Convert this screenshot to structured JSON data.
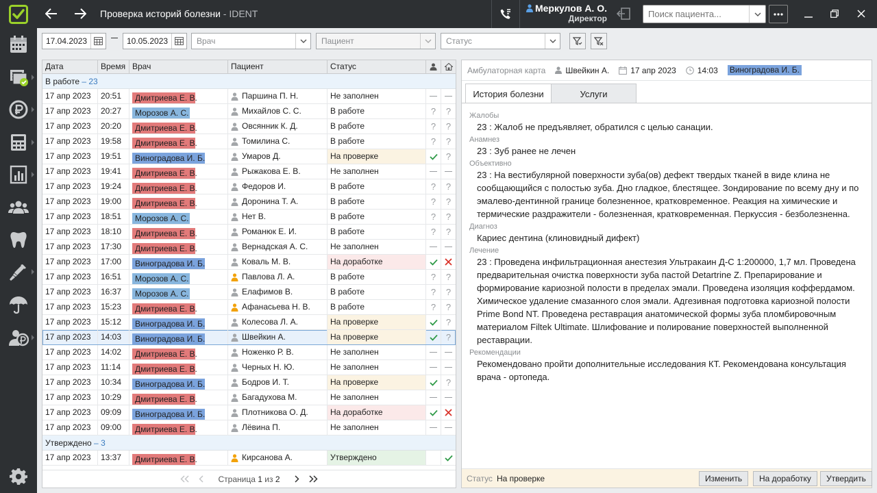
{
  "app": {
    "title": "Проверка историй болезни",
    "name": "IDENT"
  },
  "user": {
    "name": "Меркулов А. О.",
    "role": "Директор"
  },
  "search": {
    "placeholder": "Поиск пациента..."
  },
  "filters": {
    "date_from": "17.04.2023",
    "date_to": "10.05.2023",
    "doctor_placeholder": "Врач",
    "patient_placeholder": "Пациент",
    "status_placeholder": "Статус"
  },
  "table": {
    "columns": [
      "Дата",
      "Время",
      "Врач",
      "Пациент",
      "Статус"
    ],
    "groups": [
      {
        "label": "В работе",
        "count": "23",
        "rows": [
          {
            "date": "17 апр 2023",
            "time": "20:51",
            "doctor": "Дмитриева Е. В.",
            "doc_color": "red",
            "patient": "Паршина П. Н.",
            "patient_icon": "person-gray",
            "status": "Не заполнен",
            "st": "",
            "i1": "dash",
            "i2": "dash"
          },
          {
            "date": "17 апр 2023",
            "time": "20:27",
            "doctor": "Морозов А. С.",
            "doc_color": "blue",
            "patient": "Михайлов С. С.",
            "patient_icon": "person-gray",
            "status": "В работе",
            "st": "",
            "i1": "q",
            "i2": "q"
          },
          {
            "date": "17 апр 2023",
            "time": "20:20",
            "doctor": "Дмитриева Е. В.",
            "doc_color": "red",
            "patient": "Овсянник К. Д.",
            "patient_icon": "person-gray",
            "status": "В работе",
            "st": "",
            "i1": "q",
            "i2": "q"
          },
          {
            "date": "17 апр 2023",
            "time": "19:58",
            "doctor": "Дмитриева Е. В.",
            "doc_color": "red",
            "patient": "Томилина С.",
            "patient_icon": "person-gray",
            "status": "В работе",
            "st": "",
            "i1": "q",
            "i2": "q"
          },
          {
            "date": "17 апр 2023",
            "time": "19:51",
            "doctor": "Виноградова И. Б.",
            "doc_color": "vin",
            "patient": "Умаров Д.",
            "patient_icon": "person-gray",
            "status": "На проверке",
            "st": "check",
            "i1": "check",
            "i2": "q"
          },
          {
            "date": "17 апр 2023",
            "time": "19:41",
            "doctor": "Дмитриева Е. В.",
            "doc_color": "red",
            "patient": "Рыжакова Е. В.",
            "patient_icon": "person-gray",
            "status": "Не заполнен",
            "st": "",
            "i1": "dash",
            "i2": "dash"
          },
          {
            "date": "17 апр 2023",
            "time": "19:24",
            "doctor": "Дмитриева Е. В.",
            "doc_color": "red",
            "patient": "Федоров И.",
            "patient_icon": "person-gray",
            "status": "В работе",
            "st": "",
            "i1": "q",
            "i2": "q"
          },
          {
            "date": "17 апр 2023",
            "time": "19:00",
            "doctor": "Дмитриева Е. В.",
            "doc_color": "red",
            "patient": "Доронина Т. А.",
            "patient_icon": "person-gray",
            "status": "В работе",
            "st": "",
            "i1": "q",
            "i2": "q"
          },
          {
            "date": "17 апр 2023",
            "time": "18:51",
            "doctor": "Морозов А. С.",
            "doc_color": "blue",
            "patient": "Нет В.",
            "patient_icon": "person-gray",
            "status": "В работе",
            "st": "",
            "i1": "q",
            "i2": "q"
          },
          {
            "date": "17 апр 2023",
            "time": "18:10",
            "doctor": "Дмитриева Е. В.",
            "doc_color": "red",
            "patient": "Романюк Е. И.",
            "patient_icon": "person-gray",
            "status": "В работе",
            "st": "",
            "i1": "q",
            "i2": "q"
          },
          {
            "date": "17 апр 2023",
            "time": "17:30",
            "doctor": "Дмитриева Е. В.",
            "doc_color": "red",
            "patient": "Вернадская А. С.",
            "patient_icon": "person-gray",
            "status": "Не заполнен",
            "st": "",
            "i1": "dash",
            "i2": "dash"
          },
          {
            "date": "17 апр 2023",
            "time": "17:00",
            "doctor": "Виноградова И. Б.",
            "doc_color": "vin",
            "patient": "Коваль М. В.",
            "patient_icon": "person-gray",
            "status": "На доработке",
            "st": "rework",
            "i1": "check",
            "i2": "cross"
          },
          {
            "date": "17 апр 2023",
            "time": "16:51",
            "doctor": "Морозов А. С.",
            "doc_color": "blue",
            "patient": "Павлова Л. А.",
            "patient_icon": "person-orange",
            "status": "В работе",
            "st": "",
            "i1": "q",
            "i2": "q"
          },
          {
            "date": "17 апр 2023",
            "time": "16:37",
            "doctor": "Морозов А. С.",
            "doc_color": "blue",
            "patient": "Елафимов В.",
            "patient_icon": "person-gray",
            "status": "В работе",
            "st": "",
            "i1": "q",
            "i2": "q"
          },
          {
            "date": "17 апр 2023",
            "time": "15:23",
            "doctor": "Дмитриева Е. В.",
            "doc_color": "red",
            "patient": "Афанасьева Н. В.",
            "patient_icon": "person-orange",
            "status": "В работе",
            "st": "",
            "i1": "q",
            "i2": "q"
          },
          {
            "date": "17 апр 2023",
            "time": "15:12",
            "doctor": "Виноградова И. Б.",
            "doc_color": "vin",
            "patient": "Колесова Л. А.",
            "patient_icon": "person-gray",
            "status": "На проверке",
            "st": "check",
            "i1": "check",
            "i2": "q"
          },
          {
            "date": "17 апр 2023",
            "time": "14:03",
            "doctor": "Виноградова И. Б.",
            "doc_color": "vin",
            "patient": "Швейкин А.",
            "patient_icon": "person-gray",
            "status": "На проверке",
            "st": "check",
            "i1": "check",
            "i2": "q",
            "selected": true
          },
          {
            "date": "17 апр 2023",
            "time": "14:02",
            "doctor": "Дмитриева Е. В.",
            "doc_color": "red",
            "patient": "Ноженко Р. В.",
            "patient_icon": "person-gray",
            "status": "Не заполнен",
            "st": "",
            "i1": "dash",
            "i2": "dash"
          },
          {
            "date": "17 апр 2023",
            "time": "11:14",
            "doctor": "Дмитриева Е. В.",
            "doc_color": "red",
            "patient": "Черных Н. Ю.",
            "patient_icon": "person-gray",
            "status": "Не заполнен",
            "st": "",
            "i1": "dash",
            "i2": "dash"
          },
          {
            "date": "17 апр 2023",
            "time": "10:34",
            "doctor": "Виноградова И. Б.",
            "doc_color": "vin",
            "patient": "Бодров И. Т.",
            "patient_icon": "person-gray",
            "status": "На проверке",
            "st": "check",
            "i1": "check",
            "i2": "q"
          },
          {
            "date": "17 апр 2023",
            "time": "10:29",
            "doctor": "Дмитриева Е. В.",
            "doc_color": "red",
            "patient": "Багадухова М.",
            "patient_icon": "person-gray",
            "status": "Не заполнен",
            "st": "",
            "i1": "dash",
            "i2": "dash"
          },
          {
            "date": "17 апр 2023",
            "time": "09:09",
            "doctor": "Виноградова И. Б.",
            "doc_color": "vin",
            "patient": "Плотникова О. Д.",
            "patient_icon": "person-gray",
            "status": "На доработке",
            "st": "rework",
            "i1": "check",
            "i2": "cross"
          },
          {
            "date": "17 апр 2023",
            "time": "09:00",
            "doctor": "Дмитриева Е. В.",
            "doc_color": "red",
            "patient": "Лёвина П.",
            "patient_icon": "person-gray",
            "status": "Не заполнен",
            "st": "",
            "i1": "dash",
            "i2": "dash"
          }
        ]
      },
      {
        "label": "Утверждено",
        "count": "3",
        "rows": [
          {
            "date": "17 апр 2023",
            "time": "13:37",
            "doctor": "Дмитриева Е. В.",
            "doc_color": "red",
            "patient": "Кирсанова А.",
            "patient_icon": "person-orange",
            "status": "Утверждено",
            "st": "ok",
            "i1": "none",
            "i2": "check"
          }
        ]
      }
    ]
  },
  "pager": {
    "label": "Страница",
    "current": "1",
    "sep": "из",
    "total": "2"
  },
  "detail": {
    "card_label": "Амбулаторная карта",
    "patient": "Швейкин А.",
    "date": "17 апр 2023",
    "time": "14:03",
    "doctor": "Виноградова И. Б.",
    "tabs": [
      "История болезни",
      "Услуги"
    ],
    "sections": [
      {
        "title": "Жалобы",
        "text": "23 : Жалоб не предъявляет, обратился с целью санации."
      },
      {
        "title": "Анамнез",
        "text": "23 : Зуб ранее не лечен"
      },
      {
        "title": "Объективно",
        "text": "23 : На вестибулярной поверхности зуба(ов) дефект твердых тканей в виде клина не сообщающийся с полостью зуба. Дно гладкое, блестящее. Зондирование по всему дну и по эмалево-дентинной границе болезненное, кратковременное. Реакция на химические и термические раздражители - болезненная, кратковременная. Перкуссия - безболезненна."
      },
      {
        "title": "Диагноз",
        "text": "Кариес дентина (клиновидный дифект)"
      },
      {
        "title": "Лечение",
        "text": "23 : Проведена инфильтрационная анестезия Ультракаин Д-С 1:200000, 1,7 мл. Проведена предварительная очистка поверхности зуба пастой Detartrine Z. Препарирование и формирование кариозной полости в пределах эмали. Проведена изоляция коффердамом. Химическое удаление смазанного слоя эмали. Адгезивная подготовка кариозной полости Prime Bond NT. Проведена реставрация анатомической формы зуба пломбировочным материалом Filtek Ultimate. Шлифование и полирование поверхностей выполненной реставрации."
      },
      {
        "title": "Рекомендации",
        "text": "Рекомендовано пройти дополнительные исследования КТ. Рекомендована консультация врача - ортопеда."
      }
    ],
    "status_label": "Статус",
    "status_value": "На проверке",
    "buttons": {
      "change": "Изменить",
      "rework": "На доработку",
      "approve": "Утвердить"
    }
  },
  "colors": {
    "doc_red": "#e27a7a",
    "doc_blue": "#88b6de",
    "doc_vin": "#7ba3dd",
    "check": "#2e9a47",
    "cross": "#d9342b",
    "accent_logo": "#9bd12a"
  },
  "sidebar": [
    "calendar-icon",
    "records-check-icon",
    "payments-icon",
    "calculator-icon",
    "reports-icon",
    "patients-icon",
    "tooth-icon",
    "syringe-icon",
    "insurance-icon",
    "finance-icon",
    "settings-icon"
  ]
}
